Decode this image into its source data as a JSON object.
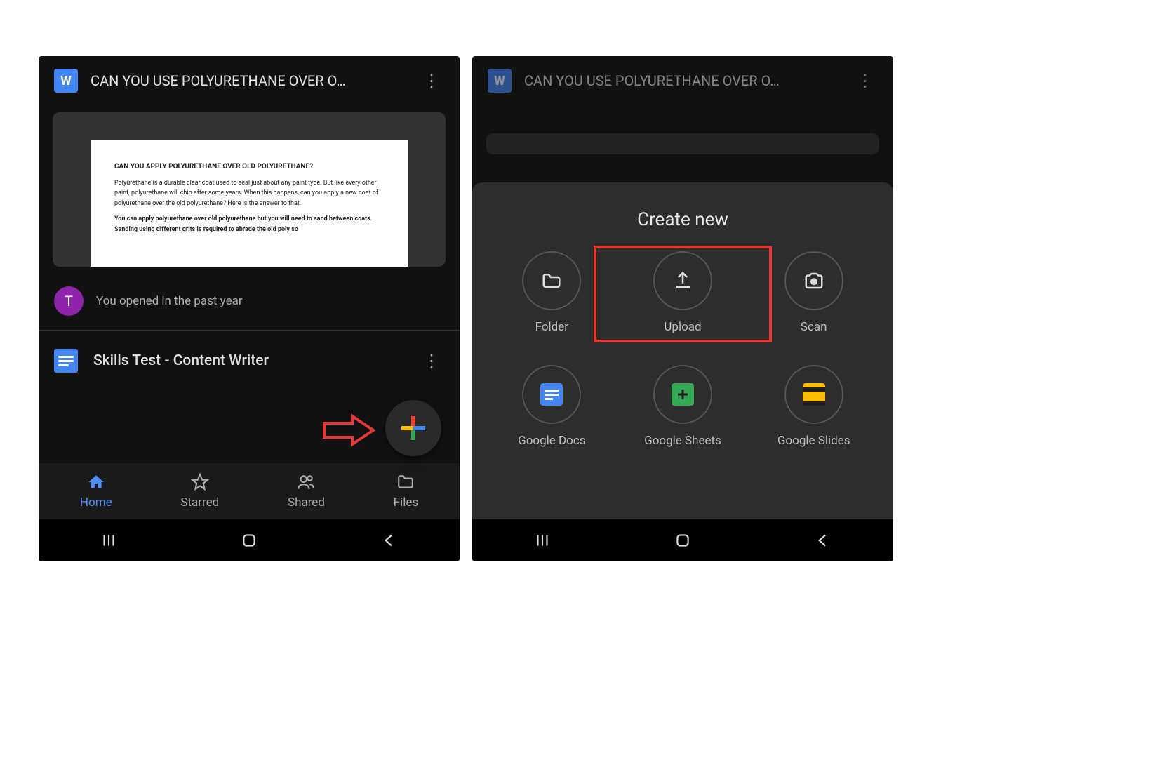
{
  "left": {
    "file1": {
      "icon_letter": "W",
      "title": "CAN YOU USE POLYURETHANE OVER O…",
      "doc_heading": "CAN YOU APPLY POLYURETHANE OVER OLD POLYURETHANE?",
      "doc_p1": "Polyurethane is a durable clear coat used to seal just about any paint type. But like every other paint, polyurethane will chip after some years. When this happens, can you apply a new coat of polyurethane over the old polyurethane? Here is the answer to that.",
      "doc_p2": "You can apply polyurethane over old polyurethane but you will need to sand between coats. Sanding using different grits is required to abrade the old poly so"
    },
    "avatar_letter": "T",
    "opened_text": "You opened in the past year",
    "file2_title": "Skills Test - Content Writer",
    "nav": {
      "home": "Home",
      "starred": "Starred",
      "shared": "Shared",
      "files": "Files"
    }
  },
  "right": {
    "file1_title": "CAN YOU USE POLYURETHANE OVER O…",
    "sheet_title": "Create new",
    "items": {
      "folder": "Folder",
      "upload": "Upload",
      "scan": "Scan",
      "docs": "Google Docs",
      "sheets": "Google Sheets",
      "slides": "Google Slides"
    }
  }
}
